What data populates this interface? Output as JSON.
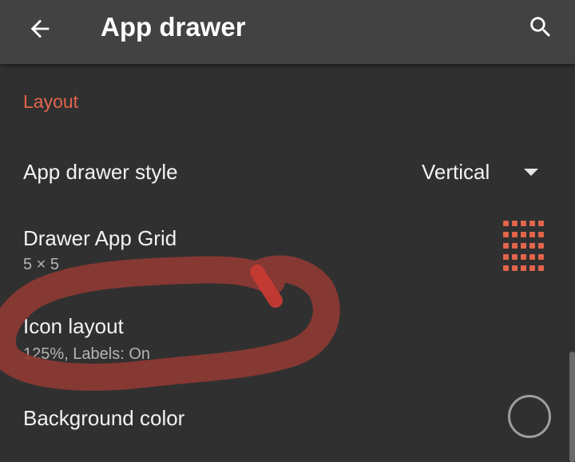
{
  "toolbar": {
    "title": "App drawer",
    "back_icon": "arrow-back-icon",
    "search_icon": "search-icon",
    "background_color": "#424242"
  },
  "section": {
    "title": "Layout",
    "accent_color": "#e2644b"
  },
  "items": [
    {
      "title": "App drawer style",
      "dropdown_value": "Vertical",
      "icon": "chevron-down-icon"
    },
    {
      "title": "Drawer App Grid",
      "summary": "5 × 5",
      "icon": "grid-icon"
    },
    {
      "title": "Icon layout",
      "summary": "125%, Labels: On"
    },
    {
      "title": "Background color",
      "icon": "color-circle-icon"
    }
  ],
  "annotation": {
    "color": "#8e3a33"
  }
}
